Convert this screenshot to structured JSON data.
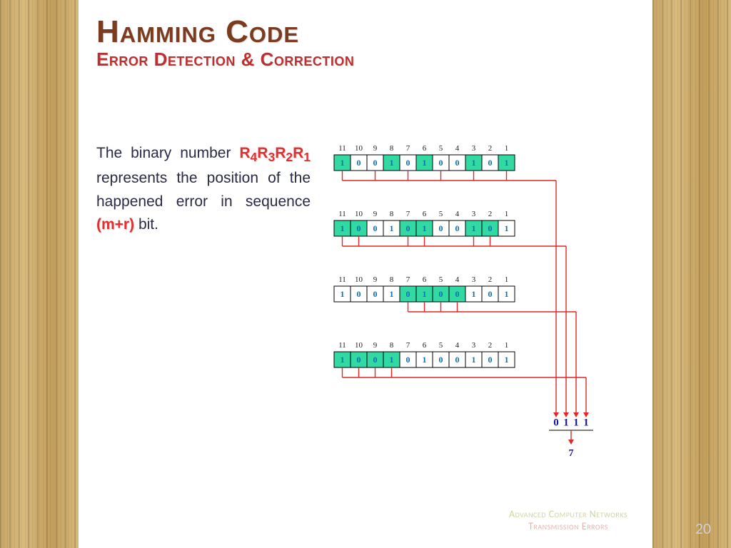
{
  "title": "Hamming Code",
  "subtitle": "Error Detection & Correction",
  "prose": {
    "p1_a": "The binary number ",
    "r_seq": [
      "R",
      "4",
      "R",
      "3",
      "R",
      "2",
      "R",
      "1"
    ],
    "p1_b": " represents the position of the happened error in sequence ",
    "mr": "(m+r)",
    "p1_c": " bit."
  },
  "diagram": {
    "positions": [
      "11",
      "10",
      "9",
      "8",
      "7",
      "6",
      "5",
      "4",
      "3",
      "2",
      "1"
    ],
    "rows": [
      {
        "bits": [
          "1",
          "0",
          "0",
          "1",
          "0",
          "1",
          "0",
          "0",
          "1",
          "0",
          "1"
        ],
        "highlight": [
          true,
          false,
          false,
          true,
          false,
          true,
          false,
          false,
          true,
          false,
          true
        ],
        "tapsFromRight": [
          0,
          2,
          4,
          6,
          8,
          10
        ]
      },
      {
        "bits": [
          "1",
          "0",
          "0",
          "1",
          "0",
          "1",
          "0",
          "0",
          "1",
          "0",
          "1"
        ],
        "highlight": [
          true,
          true,
          false,
          false,
          true,
          true,
          false,
          false,
          true,
          true,
          false
        ],
        "tapsFromRight": [
          1,
          2,
          5,
          6,
          9,
          10
        ]
      },
      {
        "bits": [
          "1",
          "0",
          "0",
          "1",
          "0",
          "1",
          "0",
          "0",
          "1",
          "0",
          "1"
        ],
        "highlight": [
          false,
          false,
          false,
          false,
          true,
          true,
          true,
          true,
          false,
          false,
          false
        ],
        "tapsFromRight": [
          3,
          4,
          5,
          6
        ]
      },
      {
        "bits": [
          "1",
          "0",
          "0",
          "1",
          "0",
          "1",
          "0",
          "0",
          "1",
          "0",
          "1"
        ],
        "highlight": [
          true,
          true,
          true,
          true,
          false,
          false,
          false,
          false,
          false,
          false,
          false
        ],
        "tapsFromRight": [
          7,
          8,
          9,
          10
        ]
      }
    ],
    "result_bits": [
      "0",
      "1",
      "1",
      "1"
    ],
    "result_value": "7"
  },
  "footer": {
    "line1": "Advanced Computer Networks",
    "line2": "Transmission Errors"
  },
  "page_number": "20"
}
